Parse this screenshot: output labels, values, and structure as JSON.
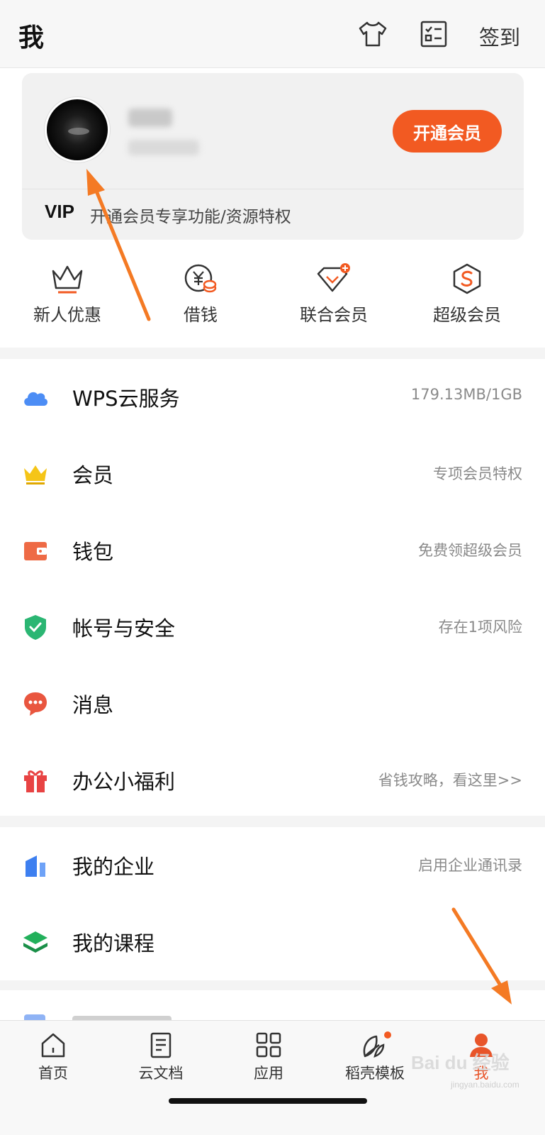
{
  "header": {
    "title": "我",
    "signin_label": "签到"
  },
  "profile": {
    "vip_button_label": "开通会员",
    "vip_tag": "VIP",
    "vip_desc": "开通会员专享功能/资源特权"
  },
  "quick_actions": [
    {
      "label": "新人优惠",
      "icon": "crown-outline-icon"
    },
    {
      "label": "借钱",
      "icon": "yen-coin-icon"
    },
    {
      "label": "联合会员",
      "icon": "diamond-plus-icon"
    },
    {
      "label": "超级会员",
      "icon": "super-s-hexagon-icon"
    }
  ],
  "menu_group1": [
    {
      "label": "WPS云服务",
      "value": "179.13MB/1GB",
      "icon": "cloud-icon"
    },
    {
      "label": "会员",
      "value": "专项会员特权",
      "icon": "crown-icon"
    },
    {
      "label": "钱包",
      "value": "免费领超级会员",
      "icon": "wallet-icon"
    },
    {
      "label": "帐号与安全",
      "value": "存在1项风险",
      "icon": "shield-icon"
    },
    {
      "label": "消息",
      "value": "",
      "icon": "message-icon"
    },
    {
      "label": "办公小福利",
      "value": "省钱攻略，看这里>>",
      "icon": "gift-icon"
    }
  ],
  "menu_group2": [
    {
      "label": "我的企业",
      "value": "启用企业通讯录",
      "icon": "enterprise-icon"
    },
    {
      "label": "我的课程",
      "value": "",
      "icon": "course-icon"
    }
  ],
  "tabbar": [
    {
      "label": "首页",
      "icon": "home-icon"
    },
    {
      "label": "云文档",
      "icon": "cloud-doc-icon"
    },
    {
      "label": "应用",
      "icon": "apps-grid-icon"
    },
    {
      "label": "稻壳模板",
      "icon": "leaf-template-icon"
    },
    {
      "label": "我",
      "icon": "user-icon"
    }
  ],
  "watermark": {
    "text": "Bai du 经验",
    "sub": "jingyan.baidu.com"
  },
  "colors": {
    "accent": "#f25a22",
    "cloud": "#4c8df5",
    "crown": "#f5c518",
    "wallet": "#ee6a45",
    "shield": "#2bb673",
    "message": "#e9563f",
    "gift": "#e84343",
    "enterprise": "#3d7ff0",
    "course": "#22b05b",
    "arrow": "#f47a24"
  }
}
